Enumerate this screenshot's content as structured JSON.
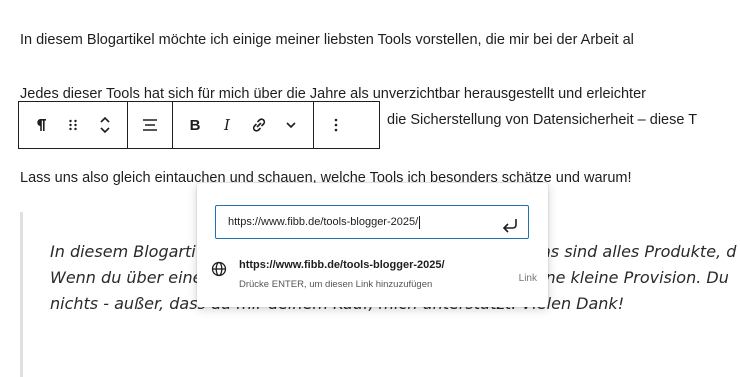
{
  "content": {
    "p1": "In diesem Blogartikel möchte ich einige meiner liebsten Tools vorstellen, die mir bei der Arbeit al",
    "p2": "Jedes dieser Tools hat sich für mich über die Jahre als unverzichtbar herausgestellt und erleichter",
    "p2_cont": "die Sicherstellung von Datensicherheit – diese T",
    "p3": "Lass uns also gleich eintauchen und schauen, welche Tools ich besonders schätze und warum!"
  },
  "quote": {
    "line1_left": "In diesem Blogarti",
    "line1_right": "as sind alles Produkte, d",
    "line2_left": "Wenn du über eine",
    "line2_right": "ine kleine Provision. Du",
    "line3": "nichts - außer, dass du mir deinem Kauf, mich unterstützt. Vielen Dank!"
  },
  "toolbar": {
    "paragraph_icon": "pilcrow-icon",
    "drag_icon": "drag-handle-icon",
    "move_icon": "move-up-down-icon",
    "align_icon": "align-icon",
    "bold_label": "B",
    "italic_label": "I",
    "link_icon": "link-icon",
    "more_icon": "chevron-down-icon",
    "options_icon": "vertical-ellipsis-icon"
  },
  "link_popover": {
    "input_value": "https://www.fibb.de/tools-blogger-2025/",
    "suggestion_url": "https://www.fibb.de/tools-blogger-2025/",
    "suggestion_hint": "Drücke ENTER, um diesen Link hinzuzufügen",
    "suggestion_type": "Link",
    "accent_color": "#2271b1"
  }
}
